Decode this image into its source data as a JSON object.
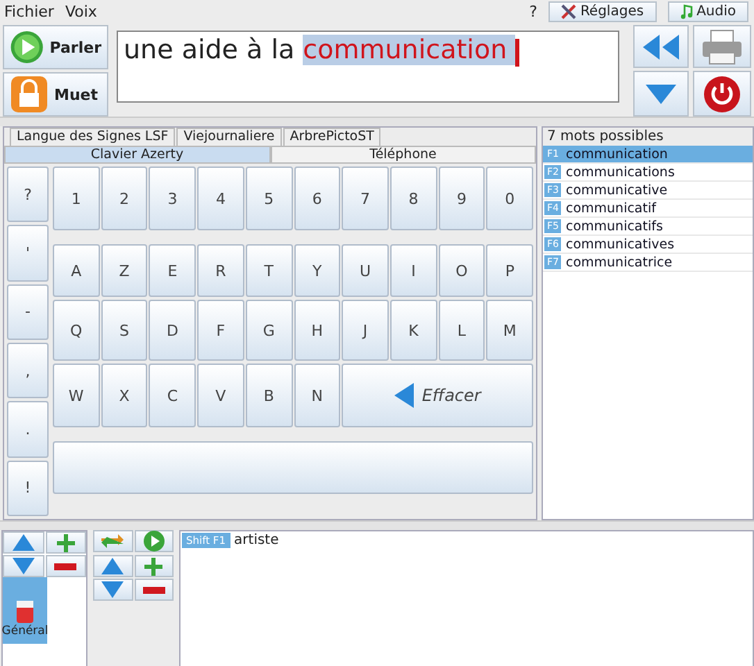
{
  "menu": [
    {
      "label": "Fichier"
    },
    {
      "label": "Voix"
    }
  ],
  "help": "?",
  "toolbar_buttons": [
    {
      "label": "Réglages",
      "kind": "settings"
    },
    {
      "label": "Audio",
      "kind": "audio"
    }
  ],
  "speech_buttons": [
    {
      "label": "Parler",
      "kind": "play"
    },
    {
      "label": "Muet",
      "kind": "lock"
    }
  ],
  "editor": {
    "text": "une aide à la ",
    "current_word": "communication"
  },
  "side_buttons": [
    {
      "kind": "back"
    },
    {
      "kind": "print"
    },
    {
      "kind": "down"
    },
    {
      "kind": "power"
    }
  ],
  "tabs_top": [
    {
      "label": "Langue des Signes LSF",
      "selected": false
    },
    {
      "label": "Viejournaliere",
      "selected": false
    },
    {
      "label": "ArbrePictoST",
      "selected": false
    }
  ],
  "tabs_keyboard": [
    {
      "label": "Clavier Azerty",
      "selected": true
    },
    {
      "label": "Téléphone",
      "selected": false
    }
  ],
  "punctuation_keys": [
    "?",
    "'",
    "-",
    ",",
    ".",
    "!"
  ],
  "key_rows": [
    [
      "1",
      "2",
      "3",
      "4",
      "5",
      "6",
      "7",
      "8",
      "9",
      "0"
    ],
    [
      "A",
      "Z",
      "E",
      "R",
      "T",
      "Y",
      "U",
      "I",
      "O",
      "P"
    ],
    [
      "Q",
      "S",
      "D",
      "F",
      "G",
      "H",
      "J",
      "K",
      "L",
      "M"
    ],
    [
      "W",
      "X",
      "C",
      "V",
      "B",
      "N"
    ]
  ],
  "erase_key": "Effacer",
  "predictions": {
    "title": "7 mots possibles",
    "items": [
      {
        "shortcut": "F1",
        "word": "communication",
        "selected": true
      },
      {
        "shortcut": "F2",
        "word": "communications",
        "selected": false
      },
      {
        "shortcut": "F3",
        "word": "communicative",
        "selected": false
      },
      {
        "shortcut": "F4",
        "word": "communicatif",
        "selected": false
      },
      {
        "shortcut": "F5",
        "word": "communicatifs",
        "selected": false
      },
      {
        "shortcut": "F6",
        "word": "communicatives",
        "selected": false
      },
      {
        "shortcut": "F7",
        "word": "communicatrice",
        "selected": false
      }
    ]
  },
  "categories": [
    {
      "label": "Général",
      "selected": true
    }
  ],
  "phrases": [
    {
      "shortcut": "Shift F1",
      "text": "artiste"
    }
  ]
}
